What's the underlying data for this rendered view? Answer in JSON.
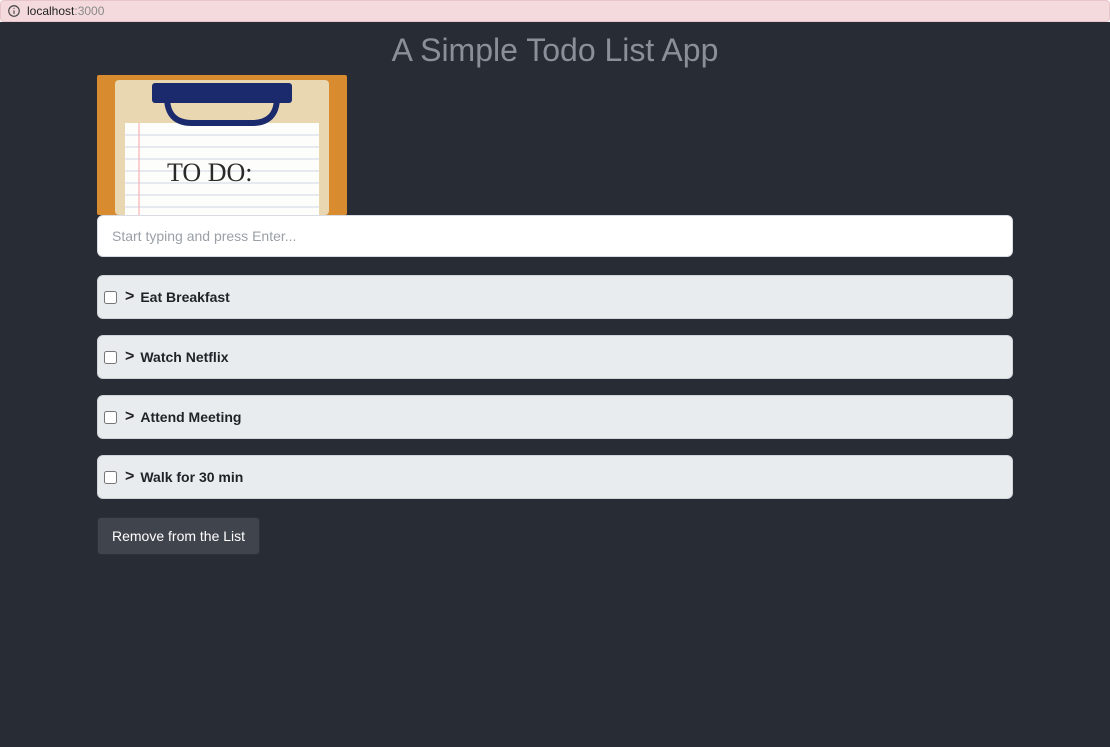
{
  "browser": {
    "url_host": "localhost",
    "url_port": ":3000"
  },
  "header": {
    "title": "A Simple Todo List App"
  },
  "image": {
    "text_line": "TO DO:"
  },
  "input": {
    "placeholder": "Start typing and press Enter..."
  },
  "items": [
    {
      "checked": false,
      "label": "Eat Breakfast"
    },
    {
      "checked": false,
      "label": "Watch Netflix"
    },
    {
      "checked": false,
      "label": "Attend Meeting"
    },
    {
      "checked": false,
      "label": "Walk for 30 min"
    }
  ],
  "buttons": {
    "remove_label": "Remove from the List"
  },
  "colors": {
    "app_bg": "#282c34",
    "title_color": "#8a8f99",
    "item_bg": "#e9ecef",
    "addr_bg": "#f4dadd"
  }
}
